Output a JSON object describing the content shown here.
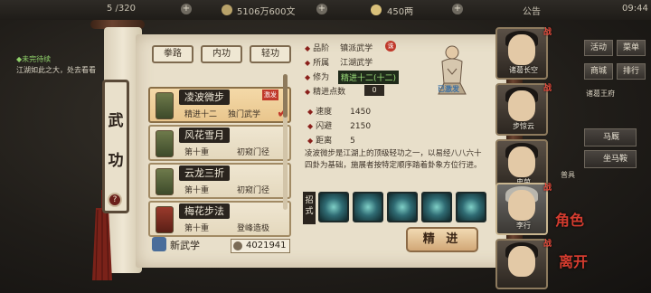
{
  "topbar": {
    "level_text": "5 /320",
    "money_text": "5106万600文",
    "gold_text": "450两",
    "notice": "公告",
    "time": "09:44"
  },
  "quest": {
    "title": "◆未完待续",
    "text": "江湖如此之大，处去看看"
  },
  "scroll_title": [
    "武",
    "功"
  ],
  "tabs": [
    "拳路",
    "内功",
    "轻功"
  ],
  "skills": [
    {
      "name": "凌波微步",
      "level": "精进十二",
      "tier": "独门武学",
      "badge": "激发",
      "selected": true,
      "book": "green"
    },
    {
      "name": "风花雪月",
      "level": "第十重",
      "tier": "初窥门径",
      "badge": "",
      "selected": false,
      "book": "green"
    },
    {
      "name": "云龙三折",
      "level": "第十重",
      "tier": "初窥门径",
      "badge": "",
      "selected": false,
      "book": "green"
    },
    {
      "name": "梅花步法",
      "level": "第十重",
      "tier": "登峰造极",
      "badge": "",
      "selected": false,
      "book": "red"
    }
  ],
  "new_skill_label": "新武学",
  "points_value": "4021941",
  "detail": {
    "quality_label": "品阶",
    "quality_value": "镇派武学",
    "quality_badge": "诛",
    "type_label": "所属",
    "type_value": "江湖武学",
    "cultivation_label": "修为",
    "cultivation_value": "精进十二(十二)",
    "points_label": "精进点数",
    "points_value": "0",
    "monk_label": "已激发",
    "stats": [
      {
        "label": "速度",
        "value": "1450"
      },
      {
        "label": "闪避",
        "value": "2150"
      },
      {
        "label": "距离",
        "value": "5"
      }
    ],
    "description": "凌波微步是江湖上的顶级轻功之一，以易经八八六十四卦为基础，施展者按特定顺序踏着卦象方位行进。",
    "moves_label": "招式"
  },
  "upgrade_button": "精 进",
  "roster": [
    {
      "name": "诸葛长空",
      "selected": false
    },
    {
      "name": "步惊云",
      "selected": false
    },
    {
      "name": "史茵",
      "selected": false
    },
    {
      "name": "李行",
      "selected": true
    },
    {
      "name": "",
      "selected": false
    }
  ],
  "menus": {
    "row1": [
      "活动",
      "菜单"
    ],
    "row2": [
      "商城",
      "排行"
    ],
    "row3_text": "诸葛王府",
    "mount1": "马厩",
    "mount2": "坐马鞍",
    "side_labels": [
      "角色",
      "离开"
    ],
    "equip_label": "普具"
  },
  "colors": {
    "accent_red": "#c0392b",
    "paper": "#e8dfca",
    "dark_label": "#2a241e"
  }
}
